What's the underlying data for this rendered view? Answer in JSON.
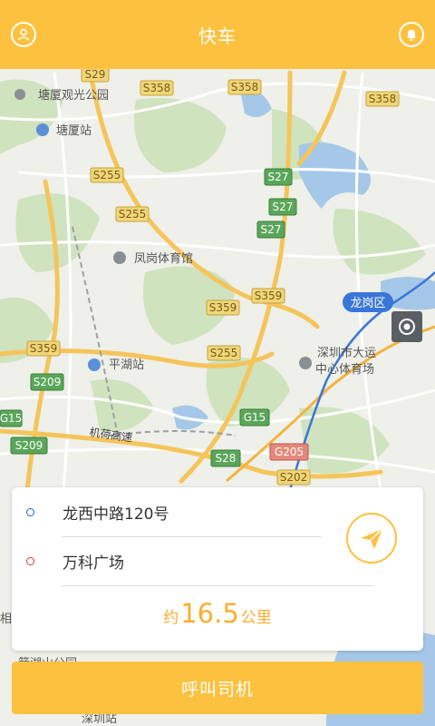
{
  "header": {
    "title": "快车"
  },
  "icons": {
    "user": "user-icon",
    "bell": "bell-icon",
    "locate": "locate-icon",
    "send": "paper-plane-icon"
  },
  "colors": {
    "brand": "#fcc13f",
    "accent_text": "#fcae2b",
    "origin_dot": "#2d5bd8",
    "dest_dot": "#e03434"
  },
  "map": {
    "pois": [
      "塘厦观光公园",
      "塘厦站",
      "凤岗体育馆",
      "平湖站",
      "深圳市大运",
      "中心体育场",
      "深圳站"
    ],
    "district": "龙岗区",
    "roads": [
      "S29",
      "S358",
      "S358",
      "S358",
      "S255",
      "S255",
      "S27",
      "S27",
      "S27",
      "S359",
      "S359",
      "S359",
      "S255",
      "S209",
      "G15",
      "S209",
      "G15",
      "S28",
      "G205",
      "S202"
    ],
    "expressway": "机荷高速",
    "misc": [
      "相",
      "箭湖山公园"
    ]
  },
  "route": {
    "origin": "龙西中路120号",
    "destination": "万科广场"
  },
  "distance": {
    "prefix": "约",
    "value": "16.5",
    "unit": "公里"
  },
  "call_button": {
    "label": "呼叫司机"
  }
}
